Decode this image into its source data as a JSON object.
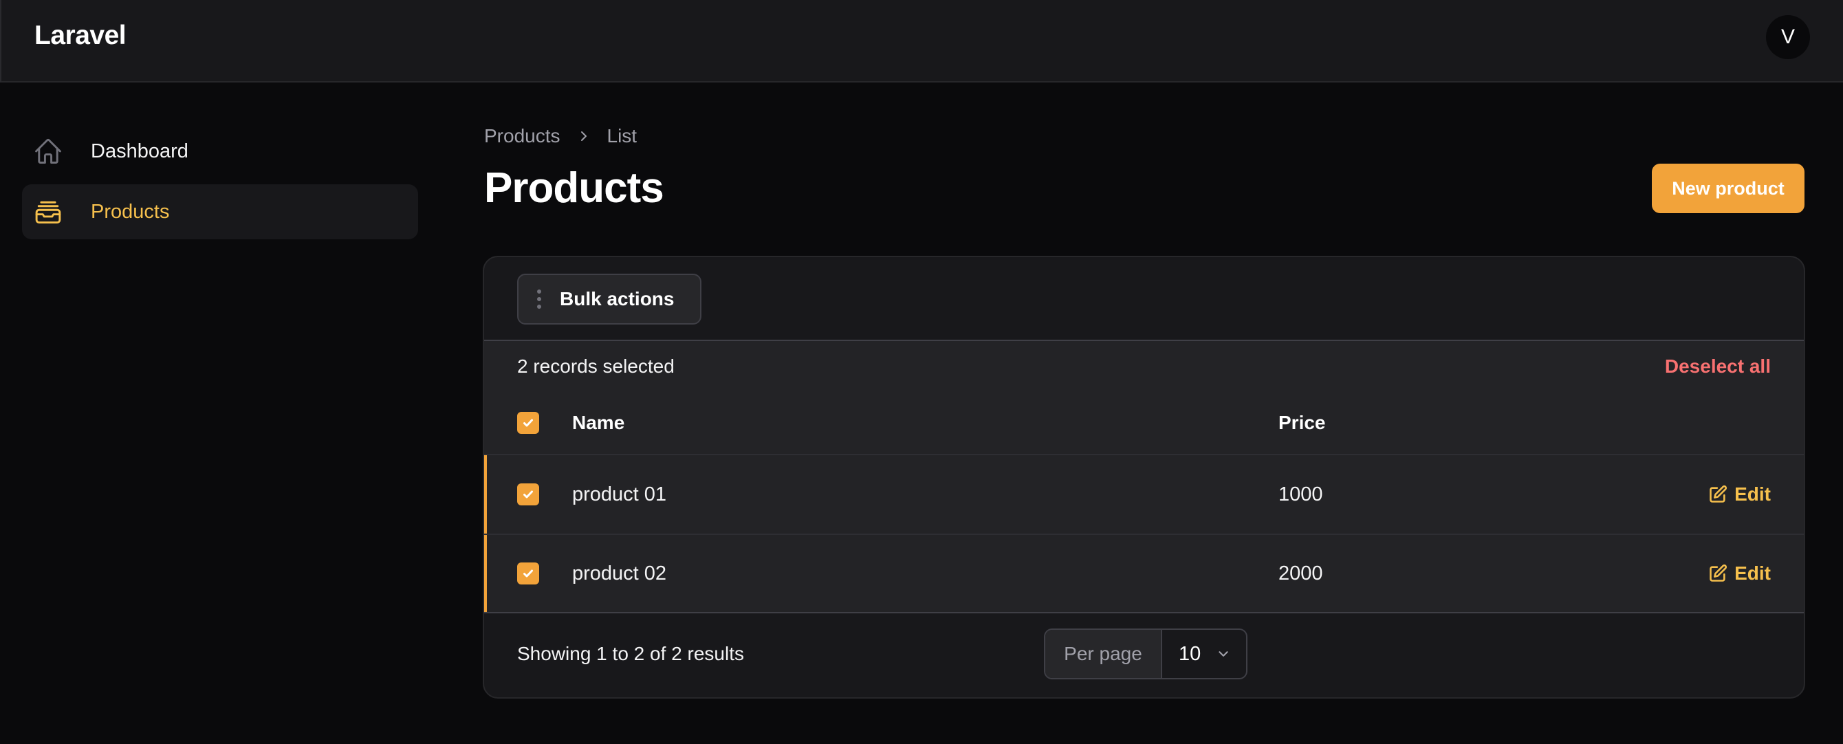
{
  "brand": "Laravel",
  "user": {
    "avatar_initial": "V"
  },
  "sidebar": {
    "items": [
      {
        "label": "Dashboard",
        "icon": "home-icon",
        "active": false
      },
      {
        "label": "Products",
        "icon": "inbox-stack-icon",
        "active": true
      }
    ]
  },
  "breadcrumb": {
    "items": [
      "Products",
      "List"
    ]
  },
  "page": {
    "title": "Products",
    "new_button": "New product"
  },
  "table": {
    "bulk_actions_label": "Bulk actions",
    "selection_text": "2 records selected",
    "deselect_label": "Deselect all",
    "columns": [
      "Name",
      "Price"
    ],
    "rows": [
      {
        "name": "product 01",
        "price": "1000",
        "selected": true,
        "action": "Edit"
      },
      {
        "name": "product 02",
        "price": "2000",
        "selected": true,
        "action": "Edit"
      }
    ],
    "footer_text": "Showing 1 to 2 of 2 results",
    "per_page_label": "Per page",
    "per_page_value": "10"
  },
  "colors": {
    "accent": "#f2a33a",
    "accent_text": "#f6c04d",
    "danger": "#f87171",
    "background": "#0a0a0c",
    "surface": "#18181b"
  }
}
